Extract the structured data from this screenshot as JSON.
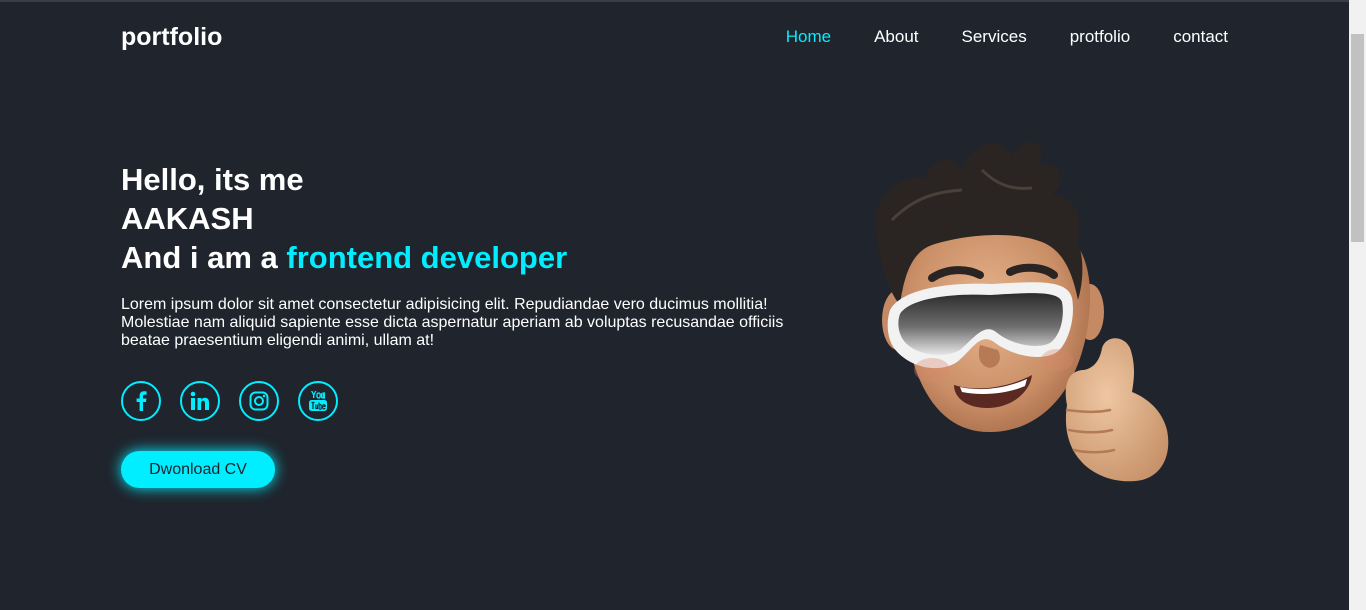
{
  "header": {
    "logo": "portfolio",
    "nav": [
      {
        "label": "Home",
        "active": true
      },
      {
        "label": "About",
        "active": false
      },
      {
        "label": "Services",
        "active": false
      },
      {
        "label": "protfolio",
        "active": false
      },
      {
        "label": "contact",
        "active": false
      }
    ]
  },
  "hero": {
    "greeting": "Hello, its me",
    "name": "AAKASH",
    "role_prefix": "And i am a ",
    "role_accent": "frontend developer",
    "description": "Lorem ipsum dolor sit amet consectetur adipisicing elit. Repudiandae vero ducimus mollitia! Molestiae nam aliquid sapiente esse dicta aspernatur aperiam ab voluptas recusandae officiis beatae praesentium eligendi animi, ullam at!",
    "social_icons": [
      "facebook-icon",
      "linkedin-icon",
      "instagram-icon",
      "youtube-icon"
    ],
    "button_label": "Dwonload CV"
  },
  "colors": {
    "background": "#1f242d",
    "accent": "#00eeff",
    "text": "#ffffff"
  }
}
